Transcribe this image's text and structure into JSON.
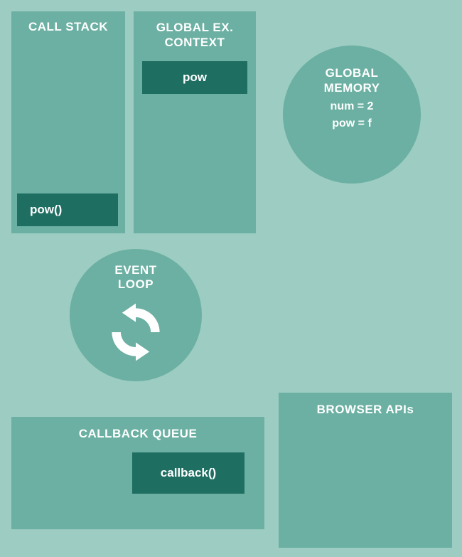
{
  "call_stack": {
    "title": "CALL STACK",
    "item": "pow()"
  },
  "gec": {
    "title_line1": "GLOBAL EX.",
    "title_line2": "CONTEXT",
    "item": "pow"
  },
  "global_memory": {
    "title_line1": "GLOBAL",
    "title_line2": "MEMORY",
    "line1": "num = 2",
    "line2": "pow = f"
  },
  "event_loop": {
    "title_line1": "EVENT",
    "title_line2": "LOOP"
  },
  "callback_queue": {
    "title": "CALLBACK QUEUE",
    "item": "callback()"
  },
  "browser_apis": {
    "title": "BROWSER APIs"
  }
}
